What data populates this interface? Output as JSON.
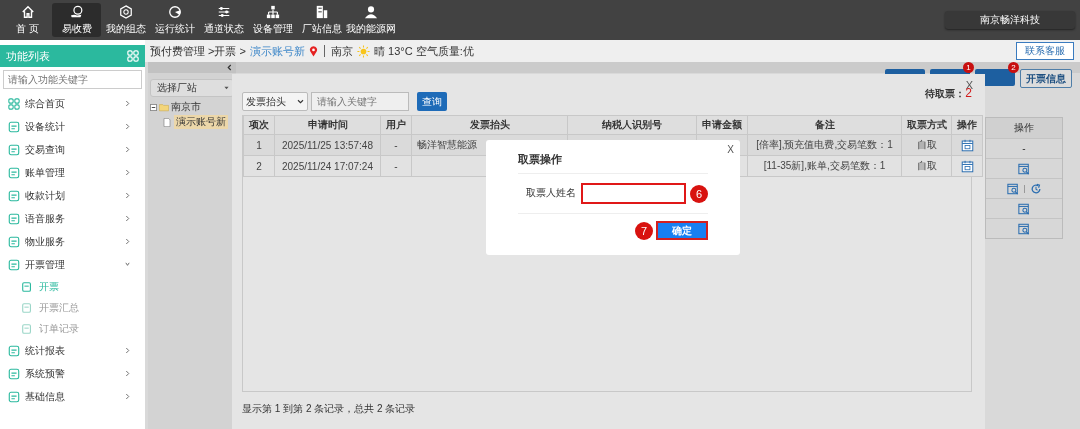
{
  "top_nav": {
    "items": [
      {
        "label": "首 页",
        "selected": false
      },
      {
        "label": "易收费",
        "selected": true
      },
      {
        "label": "我的组态",
        "selected": false
      },
      {
        "label": "运行统计",
        "selected": false
      },
      {
        "label": "通道状态",
        "selected": false
      },
      {
        "label": "设备管理",
        "selected": false
      },
      {
        "label": "厂站信息",
        "selected": false
      },
      {
        "label": "我的能源网",
        "selected": false
      }
    ],
    "company": "南京畅洋科技"
  },
  "breadcrumb": {
    "path": "预付费管理 >开票 >",
    "account": "演示账号新",
    "city": "南京",
    "weather": "晴 13°C 空气质量:优",
    "contact_button": "联系客服"
  },
  "sidebar": {
    "title": "功能列表",
    "search_placeholder": "请输入功能关键字",
    "items": [
      {
        "label": "综合首页",
        "expanded": false
      },
      {
        "label": "设备统计",
        "expanded": false
      },
      {
        "label": "交易查询",
        "expanded": false
      },
      {
        "label": "账单管理",
        "expanded": false
      },
      {
        "label": "收款计划",
        "expanded": false
      },
      {
        "label": "语音服务",
        "expanded": false
      },
      {
        "label": "物业服务",
        "expanded": false
      },
      {
        "label": "开票管理",
        "expanded": true,
        "children": [
          {
            "label": "开票",
            "selected": true
          },
          {
            "label": "开票汇总",
            "selected": false
          },
          {
            "label": "订单记录",
            "selected": false
          }
        ]
      },
      {
        "label": "统计报表",
        "expanded": false
      },
      {
        "label": "系统预警",
        "expanded": false
      },
      {
        "label": "基础信息",
        "expanded": false
      }
    ]
  },
  "station_tree": {
    "select": "选择厂站",
    "nodes": [
      {
        "label": "南京市",
        "expanded": true,
        "children": [
          {
            "label": "演示账号新",
            "selected": true
          }
        ]
      }
    ]
  },
  "background_page": {
    "toolbar_buttons": [
      {
        "kind": "plain"
      },
      {
        "kind": "badged",
        "badge": "1"
      },
      {
        "kind": "badged",
        "badge": "2"
      }
    ],
    "info_button": "开票信息",
    "table_header": "操作",
    "rows": [
      {
        "kind": "dash",
        "text": "-"
      },
      {
        "kind": "view"
      },
      {
        "kind": "view_refresh"
      },
      {
        "kind": "view"
      },
      {
        "kind": "view"
      }
    ]
  },
  "pickup_dialog": {
    "close_label": "X",
    "pending_label": "待取票：",
    "pending_count": "2",
    "filter_select": "发票抬头",
    "search_placeholder": "请输入关键字",
    "search_button": "查询",
    "columns": [
      "项次",
      "申请时间",
      "用户",
      "发票抬头",
      "纳税人识别号",
      "申请金额",
      "备注",
      "取票方式",
      "操作"
    ],
    "rows": [
      {
        "index": "1",
        "time": "2025/11/25 13:57:48",
        "user": "-",
        "title": "畅洋智慧能源",
        "remark": "[倍率],预充值电费,交易笔数：1",
        "pickup": "自取"
      },
      {
        "index": "2",
        "time": "2025/11/24 17:07:24",
        "user": "-",
        "remark": "[11-35新],账单,交易笔数：1",
        "pickup": "自取"
      }
    ],
    "footer": "显示第 1 到第 2 条记录，总共 2 条记录"
  },
  "confirm_dialog": {
    "close_label": "X",
    "title": "取票操作",
    "field_label": "取票人姓名",
    "field_step": "6",
    "button_step": "7",
    "confirm_button": "确定"
  }
}
